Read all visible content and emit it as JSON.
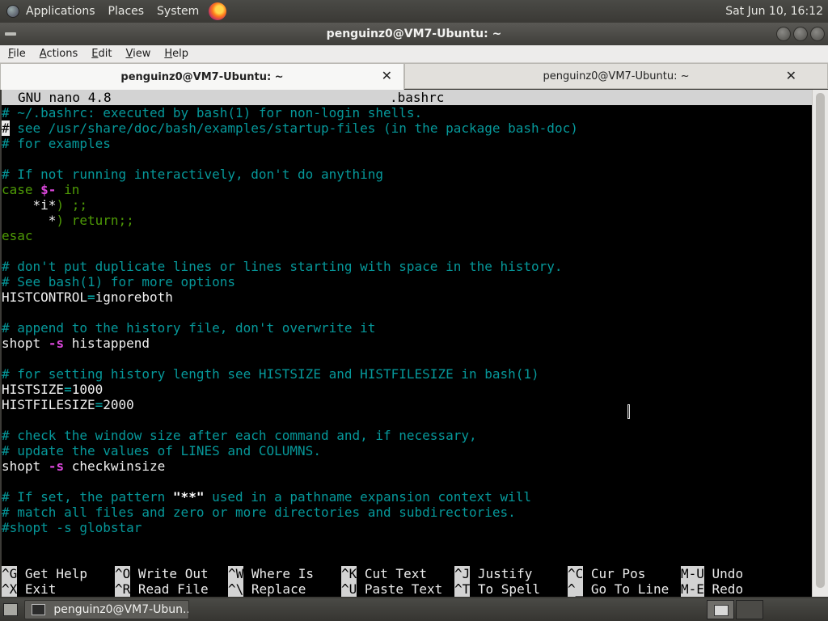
{
  "top_panel": {
    "menus": [
      "Applications",
      "Places",
      "System"
    ],
    "clock": "Sat Jun 10, 16:12"
  },
  "window": {
    "title": "penguinz0@VM7-Ubuntu: ~"
  },
  "menubar": [
    "File",
    "Actions",
    "Edit",
    "View",
    "Help"
  ],
  "tabs": [
    {
      "label": "penguinz0@VM7-Ubuntu: ~",
      "active": true
    },
    {
      "label": "penguinz0@VM7-Ubuntu: ~",
      "active": false
    }
  ],
  "nano": {
    "version": "GNU nano 4.8",
    "filename": ".bashrc",
    "lines": [
      "# ~/.bashrc: executed by bash(1) for non-login shells.",
      "# see /usr/share/doc/bash/examples/startup-files (in the package bash-doc)",
      "# for examples",
      "",
      "# If not running interactively, don't do anything",
      "case $- in",
      "    *i*) ;;",
      "      *) return;;",
      "esac",
      "",
      "# don't put duplicate lines or lines starting with space in the history.",
      "# See bash(1) for more options",
      "HISTCONTROL=ignoreboth",
      "",
      "# append to the history file, don't overwrite it",
      "shopt -s histappend",
      "",
      "# for setting history length see HISTSIZE and HISTFILESIZE in bash(1)",
      "HISTSIZE=1000",
      "HISTFILESIZE=2000",
      "",
      "# check the window size after each command and, if necessary,",
      "# update the values of LINES and COLUMNS.",
      "shopt -s checkwinsize",
      "",
      "# If set, the pattern \"**\" used in a pathname expansion context will",
      "# match all files and zero or more directories and subdirectories.",
      "#shopt -s globstar"
    ],
    "shortcuts": [
      [
        {
          "key": "^G",
          "label": "Get Help"
        },
        {
          "key": "^X",
          "label": "Exit"
        }
      ],
      [
        {
          "key": "^O",
          "label": "Write Out"
        },
        {
          "key": "^R",
          "label": "Read File"
        }
      ],
      [
        {
          "key": "^W",
          "label": "Where Is"
        },
        {
          "key": "^\\",
          "label": "Replace"
        }
      ],
      [
        {
          "key": "^K",
          "label": "Cut Text"
        },
        {
          "key": "^U",
          "label": "Paste Text"
        }
      ],
      [
        {
          "key": "^J",
          "label": "Justify"
        },
        {
          "key": "^T",
          "label": "To Spell"
        }
      ],
      [
        {
          "key": "^C",
          "label": "Cur Pos"
        },
        {
          "key": "^_",
          "label": "Go To Line"
        }
      ],
      [
        {
          "key": "M-U",
          "label": "Undo"
        },
        {
          "key": "M-E",
          "label": "Redo"
        }
      ]
    ]
  },
  "taskbar": {
    "task_label": "penguinz0@VM7-Ubun..."
  },
  "colors": {
    "comment": "#06989a",
    "keyword": "#4e9a06",
    "option": "#d946d9"
  }
}
